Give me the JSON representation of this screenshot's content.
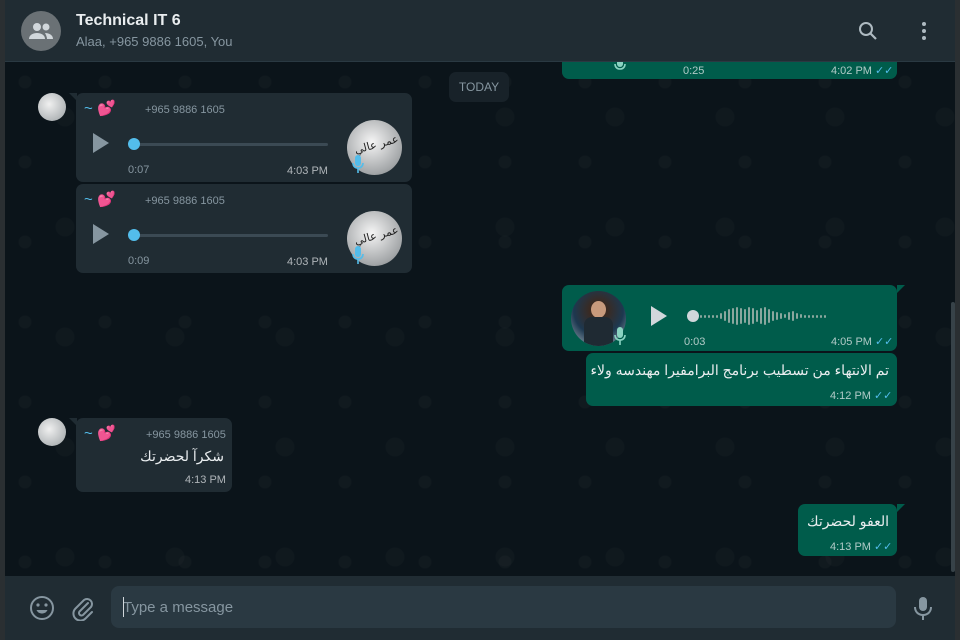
{
  "header": {
    "title": "Technical IT 6",
    "subtitle": "Alaa, +965 9886 1605, You",
    "icons": {
      "avatar": "group-icon",
      "search": "search-icon",
      "menu": "kebab-menu-icon"
    }
  },
  "chat": {
    "date_divider": "TODAY",
    "messages": [
      {
        "direction": "out",
        "type": "voice",
        "duration": "0:25",
        "time": "4:02 PM",
        "status": "read"
      },
      {
        "direction": "in",
        "type": "voice",
        "sender_name": "~",
        "sender_phone": "+965 9886 1605",
        "duration": "0:07",
        "time": "4:03 PM",
        "progress": 0
      },
      {
        "direction": "in",
        "type": "voice",
        "sender_name": "~",
        "sender_phone": "+965 9886 1605",
        "duration": "0:09",
        "time": "4:03 PM",
        "progress": 0
      },
      {
        "direction": "out",
        "type": "voice",
        "duration": "0:03",
        "time": "4:05 PM",
        "status": "read",
        "progress": 0
      },
      {
        "direction": "out",
        "type": "text",
        "text": "تم الانتهاء من تسطيب برنامج البرامفيرا مهندسه ولاء",
        "time": "4:12 PM",
        "status": "read"
      },
      {
        "direction": "in",
        "type": "text",
        "sender_name": "~",
        "sender_phone": "+965 9886 1605",
        "text": "شكرآ لحضرتك",
        "time": "4:13 PM"
      },
      {
        "direction": "out",
        "type": "text",
        "text": "العفو لحضرتك",
        "time": "4:13 PM",
        "status": "read"
      }
    ]
  },
  "footer": {
    "placeholder": "Type a message",
    "icons": {
      "emoji": "emoji-icon",
      "attach": "paperclip-icon",
      "mic": "microphone-icon"
    }
  },
  "colors": {
    "header_bg": "#202c33",
    "chat_bg": "#0b141a",
    "incoming_bubble": "#202c33",
    "outgoing_bubble": "#005c4b",
    "accent_blue": "#53bdeb",
    "muted_text": "#8696a0"
  }
}
